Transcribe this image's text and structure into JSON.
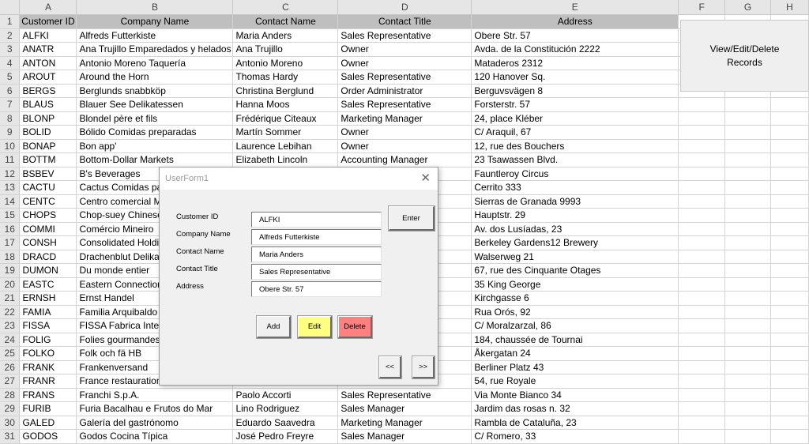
{
  "sheet": {
    "column_letters": [
      "A",
      "B",
      "C",
      "D",
      "E",
      "F",
      "G",
      "H"
    ],
    "header": [
      "Customer ID",
      "Company Name",
      "Contact Name",
      "Contact Title",
      "Address"
    ],
    "rows": [
      [
        "ALFKI",
        "Alfreds Futterkiste",
        "Maria Anders",
        "Sales Representative",
        "Obere Str. 57"
      ],
      [
        "ANATR",
        "Ana Trujillo Emparedados y helados",
        "Ana Trujillo",
        "Owner",
        "Avda. de la Constitución 2222"
      ],
      [
        "ANTON",
        "Antonio Moreno Taquería",
        "Antonio Moreno",
        "Owner",
        "Mataderos  2312"
      ],
      [
        "AROUT",
        "Around the Horn",
        "Thomas Hardy",
        "Sales Representative",
        "120 Hanover Sq."
      ],
      [
        "BERGS",
        "Berglunds snabbköp",
        "Christina Berglund",
        "Order Administrator",
        "Berguvsvägen  8"
      ],
      [
        "BLAUS",
        "Blauer See Delikatessen",
        "Hanna Moos",
        "Sales Representative",
        "Forsterstr. 57"
      ],
      [
        "BLONP",
        "Blondel père et fils",
        "Frédérique Citeaux",
        "Marketing Manager",
        "24, place Kléber"
      ],
      [
        "BOLID",
        "Bólido Comidas preparadas",
        "Martín Sommer",
        "Owner",
        "C/ Araquil, 67"
      ],
      [
        "BONAP",
        "Bon app'",
        "Laurence Lebihan",
        "Owner",
        "12, rue des Bouchers"
      ],
      [
        "BOTTM",
        "Bottom-Dollar Markets",
        "Elizabeth Lincoln",
        "Accounting Manager",
        "23 Tsawassen Blvd."
      ],
      [
        "BSBEV",
        "B's Beverages",
        "",
        "",
        "Fauntleroy Circus"
      ],
      [
        "CACTU",
        "Cactus Comidas pa",
        "",
        "",
        "Cerrito 333"
      ],
      [
        "CENTC",
        "Centro comercial M",
        "",
        "",
        "Sierras de Granada 9993"
      ],
      [
        "CHOPS",
        "Chop-suey Chinese",
        "",
        "",
        "Hauptstr. 29"
      ],
      [
        "COMMI",
        "Comércio Mineiro",
        "",
        "",
        "Av. dos Lusíadas, 23"
      ],
      [
        "CONSH",
        "Consolidated Holdi",
        "",
        "",
        "Berkeley Gardens12  Brewery"
      ],
      [
        "DRACD",
        "Drachenblut Delika",
        "",
        "",
        "Walserweg 21"
      ],
      [
        "DUMON",
        "Du monde entier",
        "",
        "",
        "67, rue des Cinquante Otages"
      ],
      [
        "EASTC",
        "Eastern Connection",
        "",
        "",
        "35 King George"
      ],
      [
        "ERNSH",
        "Ernst Handel",
        "",
        "",
        "Kirchgasse 6"
      ],
      [
        "FAMIA",
        "Familia Arquibaldo",
        "",
        "",
        "Rua Orós, 92"
      ],
      [
        "FISSA",
        "FISSA Fabrica Inter.",
        "",
        "",
        "C/ Moralzarzal, 86"
      ],
      [
        "FOLIG",
        "Folies gourmandes",
        "",
        "",
        "184, chaussée de Tournai"
      ],
      [
        "FOLKO",
        "Folk och fä HB",
        "",
        "",
        "Åkergatan 24"
      ],
      [
        "FRANK",
        "Frankenversand",
        "",
        "",
        "Berliner Platz 43"
      ],
      [
        "FRANR",
        "France restauration",
        "",
        "",
        "54, rue Royale"
      ],
      [
        "FRANS",
        "Franchi S.p.A.",
        "Paolo Accorti",
        "Sales Representative",
        "Via Monte Bianco 34"
      ],
      [
        "FURIB",
        "Furia Bacalhau e Frutos do Mar",
        "Lino Rodriguez",
        "Sales Manager",
        "Jardim das rosas n. 32"
      ],
      [
        "GALED",
        "Galería del gastrónomo",
        "Eduardo Saavedra",
        "Marketing Manager",
        "Rambla de Cataluña, 23"
      ],
      [
        "GODOS",
        "Godos Cocina Típica",
        "José Pedro Freyre",
        "Sales Manager",
        "C/ Romero, 33"
      ]
    ]
  },
  "shape_button": {
    "label": "View/Edit/Delete\nRecords"
  },
  "userform": {
    "title": "UserForm1",
    "close_glyph": "✕",
    "labels": {
      "customer_id": "Customer ID",
      "company_name": "Company Name",
      "contact_name": "Contact Name",
      "contact_title": "Contact Title",
      "address": "Address"
    },
    "values": {
      "customer_id": "ALFKI",
      "company_name": "Alfreds Futterkiste",
      "contact_name": "Maria Anders",
      "contact_title": "Sales Representative",
      "address": "Obere Str. 57"
    },
    "buttons": {
      "enter": "Enter",
      "add": "Add",
      "edit": "Edit",
      "delete": "Delete",
      "prev": "<<",
      "next": ">>"
    },
    "colors": {
      "edit": "#ffff80",
      "delete": "#ff8080",
      "face": "#f0f0f0"
    }
  }
}
